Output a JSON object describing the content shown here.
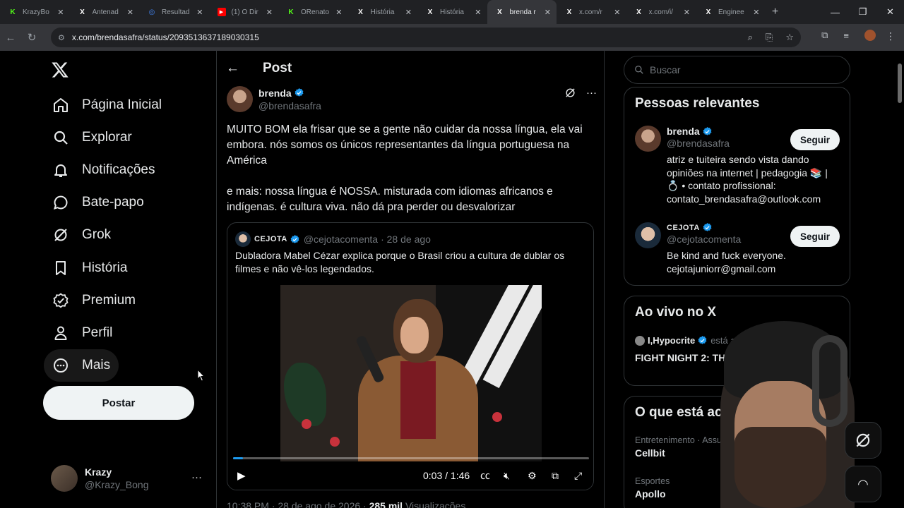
{
  "browser": {
    "tabs": [
      {
        "title": "KrazyBo",
        "icon": "kick-icon",
        "color": "#53fc18"
      },
      {
        "title": "Antenad",
        "icon": "x-icon",
        "color": "#ffffff"
      },
      {
        "title": "Resultad",
        "icon": "search-icon",
        "color": "#4285f4"
      },
      {
        "title": "(1) O Dir",
        "icon": "youtube-icon",
        "color": "#ff0000"
      },
      {
        "title": "ORenato",
        "icon": "kick-icon",
        "color": "#53fc18"
      },
      {
        "title": "História",
        "icon": "x-icon",
        "color": "#ffffff"
      },
      {
        "title": "História",
        "icon": "x-icon",
        "color": "#ffffff"
      },
      {
        "title": "brenda r",
        "icon": "x-icon",
        "color": "#ffffff"
      },
      {
        "title": "x.com/r",
        "icon": "x-icon",
        "color": "#ffffff"
      },
      {
        "title": "x.com/i/",
        "icon": "x-icon",
        "color": "#ffffff"
      },
      {
        "title": "Enginee",
        "icon": "x-icon",
        "color": "#ffffff"
      }
    ],
    "active_tab_index": 7,
    "url": "x.com/brendasafra/status/2093513637189030315"
  },
  "sidebar": {
    "items": [
      {
        "label": "Página Inicial",
        "icon": "home-icon"
      },
      {
        "label": "Explorar",
        "icon": "search-icon"
      },
      {
        "label": "Notificações",
        "icon": "bell-icon"
      },
      {
        "label": "Bate-papo",
        "icon": "chat-icon"
      },
      {
        "label": "Grok",
        "icon": "grok-icon"
      },
      {
        "label": "História",
        "icon": "bookmark-icon"
      },
      {
        "label": "Premium",
        "icon": "premium-icon"
      },
      {
        "label": "Perfil",
        "icon": "person-icon"
      },
      {
        "label": "Mais",
        "icon": "more-circle-icon"
      }
    ],
    "post_button": "Postar",
    "account": {
      "name": "Krazy",
      "handle": "@Krazy_Bong"
    }
  },
  "main": {
    "title": "Post",
    "author": {
      "name": "brenda",
      "handle": "@brendasafra"
    },
    "body": [
      "MUITO BOM ela frisar que se a gente não cuidar da nossa língua, ela vai embora. nós somos os únicos representantes da língua portuguesa na América",
      "e mais: nossa língua é NOSSA. misturada com idiomas africanos e indígenas. é cultura viva. não dá pra perder ou desvalorizar"
    ],
    "quote": {
      "name": "CEJOTA",
      "handle": "@cejotacomenta",
      "date": "· 28 de ago",
      "text": "Dubladora Mabel Cézar explica porque o Brasil criou a cultura de dublar os filmes e não vê-los legendados.",
      "video": {
        "time": "0:03 / 1:46",
        "progress": 0.028
      }
    },
    "meta": {
      "time": "10:38 PM · 28 de ago de 2026 ·",
      "views": "285 mil",
      "views_label": "Visualizações"
    }
  },
  "right": {
    "search_placeholder": "Buscar",
    "relevant": {
      "title": "Pessoas relevantes",
      "users": [
        {
          "name": "brenda",
          "handle": "@brendasafra",
          "bio": "atriz e tuiteira sendo vista dando opiniões na internet | pedagogia 📚 | 💍 • contato profissional: contato_brendasafra@outlook.com",
          "button": "Seguir"
        },
        {
          "name": "CEJOTA",
          "handle": "@cejotacomenta",
          "bio": "Be kind and fuck everyone. cejotajuniorr@gmail.com",
          "button": "Seguir"
        }
      ]
    },
    "live": {
      "title": "Ao vivo no X",
      "host": "I,Hypocrite",
      "status": "está apr",
      "event": "FIGHT NIGHT 2: TH & THE JEW"
    },
    "trending": {
      "title": "O que está ac",
      "items": [
        {
          "category": "Entretenimento · Assunto",
          "name": "Cellbit"
        },
        {
          "category": "Esportes",
          "name": "Apollo"
        }
      ]
    }
  }
}
